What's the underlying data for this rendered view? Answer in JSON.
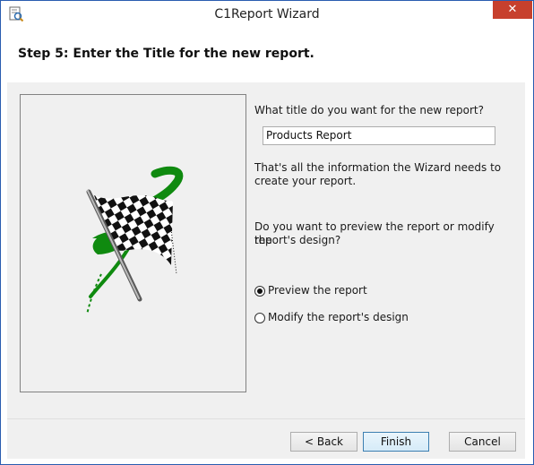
{
  "window": {
    "title": "C1Report Wizard",
    "close_glyph": "✕",
    "app_icon": "report-icon"
  },
  "header": {
    "step_title": "Step 5: Enter the Title for the new report."
  },
  "form": {
    "title_question": "What title do you want for the new report?",
    "title_value": "Products Report",
    "info_line1": "That's all the information the Wizard needs to",
    "info_line2": "create your report.",
    "preview_question_line1": "Do you want to preview the report or modify the",
    "preview_question_line2": "report's design?",
    "options": [
      {
        "label": "Preview the report",
        "selected": true
      },
      {
        "label": "Modify the report's design",
        "selected": false
      }
    ]
  },
  "footer": {
    "back_label": "< Back",
    "finish_label": "Finish",
    "cancel_label": "Cancel"
  },
  "colors": {
    "accent": "#c7402d",
    "flag_green": "#0f8a0f"
  }
}
